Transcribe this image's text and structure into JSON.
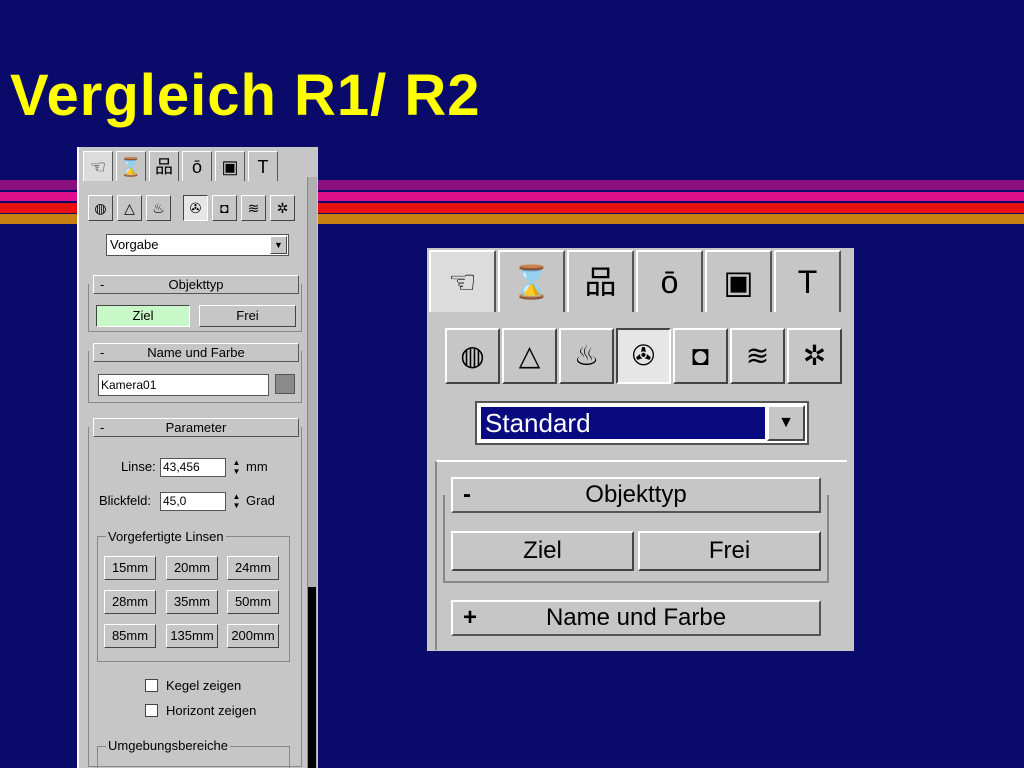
{
  "slide": {
    "title": "Vergleich R1/ R2",
    "colors": {
      "background": "#0a0a6b",
      "title": "#ffff00",
      "stripes": [
        "#8a1080",
        "#e0108a",
        "#e81010",
        "#c88010"
      ]
    }
  },
  "r1": {
    "tabs": [
      {
        "icon": "create-hand-icon",
        "glyph": "☜"
      },
      {
        "icon": "modify-icon",
        "glyph": "⌛"
      },
      {
        "icon": "hierarchy-icon",
        "glyph": "品"
      },
      {
        "icon": "motion-icon",
        "glyph": "ō"
      },
      {
        "icon": "display-icon",
        "glyph": "▣"
      },
      {
        "icon": "utilities-hammer-icon",
        "glyph": "T"
      }
    ],
    "categories": [
      {
        "icon": "geometry-icon",
        "glyph": "◍"
      },
      {
        "icon": "shapes-icon",
        "glyph": "△"
      },
      {
        "icon": "lights-icon",
        "glyph": "♨"
      },
      {
        "icon": "cameras-icon",
        "glyph": "✇"
      },
      {
        "icon": "helpers-icon",
        "glyph": "◘"
      },
      {
        "icon": "spacewarps-icon",
        "glyph": "≋"
      },
      {
        "icon": "systems-icon",
        "glyph": "✲"
      }
    ],
    "dropdown": "Vorgabe",
    "objekttyp": {
      "sign": "-",
      "title": "Objekttyp",
      "buttons": [
        "Ziel",
        "Frei"
      ]
    },
    "name_farbe": {
      "sign": "-",
      "title": "Name und Farbe",
      "value": "Kamera01"
    },
    "parameter": {
      "sign": "-",
      "title": "Parameter"
    },
    "linse": {
      "label": "Linse:",
      "value": "43,456",
      "unit": "mm"
    },
    "blickfeld": {
      "label": "Blickfeld:",
      "value": "45,0",
      "unit": "Grad"
    },
    "linsen": {
      "title": "Vorgefertigte Linsen",
      "buttons": [
        "15mm",
        "20mm",
        "24mm",
        "28mm",
        "35mm",
        "50mm",
        "85mm",
        "135mm",
        "200mm"
      ]
    },
    "checkboxes": [
      "Kegel zeigen",
      "Horizont zeigen"
    ],
    "umgebung": "Umgebungsbereiche"
  },
  "r2": {
    "tabs": [
      {
        "icon": "create-hand-icon",
        "glyph": "☜"
      },
      {
        "icon": "modify-icon",
        "glyph": "⌛"
      },
      {
        "icon": "hierarchy-icon",
        "glyph": "品"
      },
      {
        "icon": "motion-icon",
        "glyph": "ō"
      },
      {
        "icon": "display-icon",
        "glyph": "▣"
      },
      {
        "icon": "utilities-hammer-icon",
        "glyph": "T"
      }
    ],
    "categories": [
      {
        "icon": "geometry-icon",
        "glyph": "◍"
      },
      {
        "icon": "shapes-icon",
        "glyph": "△"
      },
      {
        "icon": "lights-icon",
        "glyph": "♨"
      },
      {
        "icon": "cameras-icon",
        "glyph": "✇"
      },
      {
        "icon": "helpers-icon",
        "glyph": "◘"
      },
      {
        "icon": "spacewarps-icon",
        "glyph": "≋"
      },
      {
        "icon": "systems-icon",
        "glyph": "✲"
      }
    ],
    "dropdown": "Standard",
    "objekttyp": {
      "sign": "-",
      "title": "Objekttyp",
      "buttons": [
        "Ziel",
        "Frei"
      ]
    },
    "name_farbe": {
      "sign": "+",
      "title": "Name und Farbe"
    }
  }
}
